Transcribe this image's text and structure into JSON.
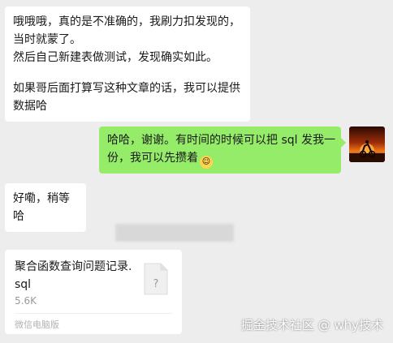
{
  "messages": {
    "first": {
      "lines": [
        "哦哦哦，真的是不准确的，我刷力扣发现的，",
        "当时就蒙了。",
        "然后自己新建表做测试，发现确实如此。"
      ],
      "lines2": [
        "如果哥后面打算写这种文章的话，我可以提供",
        "数据哈"
      ]
    },
    "reply": {
      "line1": "哈哈，谢谢。有时间的时候可以把 sql 发我一",
      "line2": "份，我可以先攒着"
    },
    "third": {
      "text": "好嘞，稍等哈"
    }
  },
  "file": {
    "name": "聚合函数查询问题记录.sql",
    "size": "5.6K",
    "source": "微信电脑版"
  },
  "watermark": "掘金技术社区 @ why技术",
  "colors": {
    "background": "#ededed",
    "sent_bubble": "#95ec69",
    "received_bubble": "#ffffff"
  }
}
